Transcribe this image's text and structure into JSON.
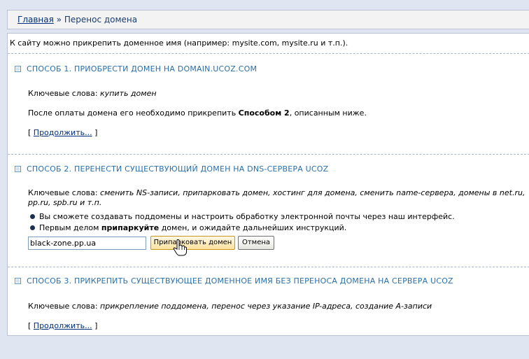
{
  "breadcrumb": {
    "home": "Главная",
    "separator": "»",
    "current": "Перенос домена"
  },
  "intro": "К сайту можно прикрепить доменное имя (например: mysite.com, mysite.ru и т.п.).",
  "section1": {
    "title": "СПОСОБ 1. ПРИОБРЕСТИ ДОМЕН НА DOMAIN.UCOZ.COM",
    "keywords_label": "Ключевые слова:",
    "keywords": "купить домен",
    "text_before": "После оплаты домена его необходимо прикрепить",
    "text_bold": "Способом 2",
    "text_after": ", описанным ниже.",
    "bracket_open": "[",
    "continue": "Продолжить...",
    "bracket_close": "]"
  },
  "section2": {
    "title": "СПОСОБ 2. ПЕРЕНЕСТИ СУЩЕСТВУЮЩИЙ ДОМЕН НА DNS-СЕРВЕРА UCOZ",
    "keywords_label": "Ключевые слова:",
    "keywords_line1": "сменить NS-записи, припарковать домен, хостинг для домена, сменить name-сервера, домены в net.ru,",
    "keywords_line2": "pp.ru, spb.ru и т.п.",
    "bullet1": "Вы сможете создавать поддомены и настроить обработку электронной почты через наш интерфейс.",
    "bullet2_before": "Первым делом",
    "bullet2_bold": "припаркуйте",
    "bullet2_after": "домен, и ожидайте дальнейших инструкций.",
    "domain_value": "black-zone.pp.ua",
    "park_button": "Припарковать домен",
    "cancel_button": "Отмена"
  },
  "section3": {
    "title": "СПОСОБ 3. ПРИКРЕПИТЬ СУЩЕСТВУЮЩЕЕ ДОМЕННОЕ ИМЯ БЕЗ ПЕРЕНОСА ДОМЕНА НА СЕРВЕРА UCOZ",
    "keywords_label": "Ключевые слова:",
    "keywords": "прикрепление поддомена, перенос через указание IP-адреса, создание A-записи",
    "bracket_open": "[",
    "continue": "Продолжить...",
    "bracket_close": "]"
  }
}
